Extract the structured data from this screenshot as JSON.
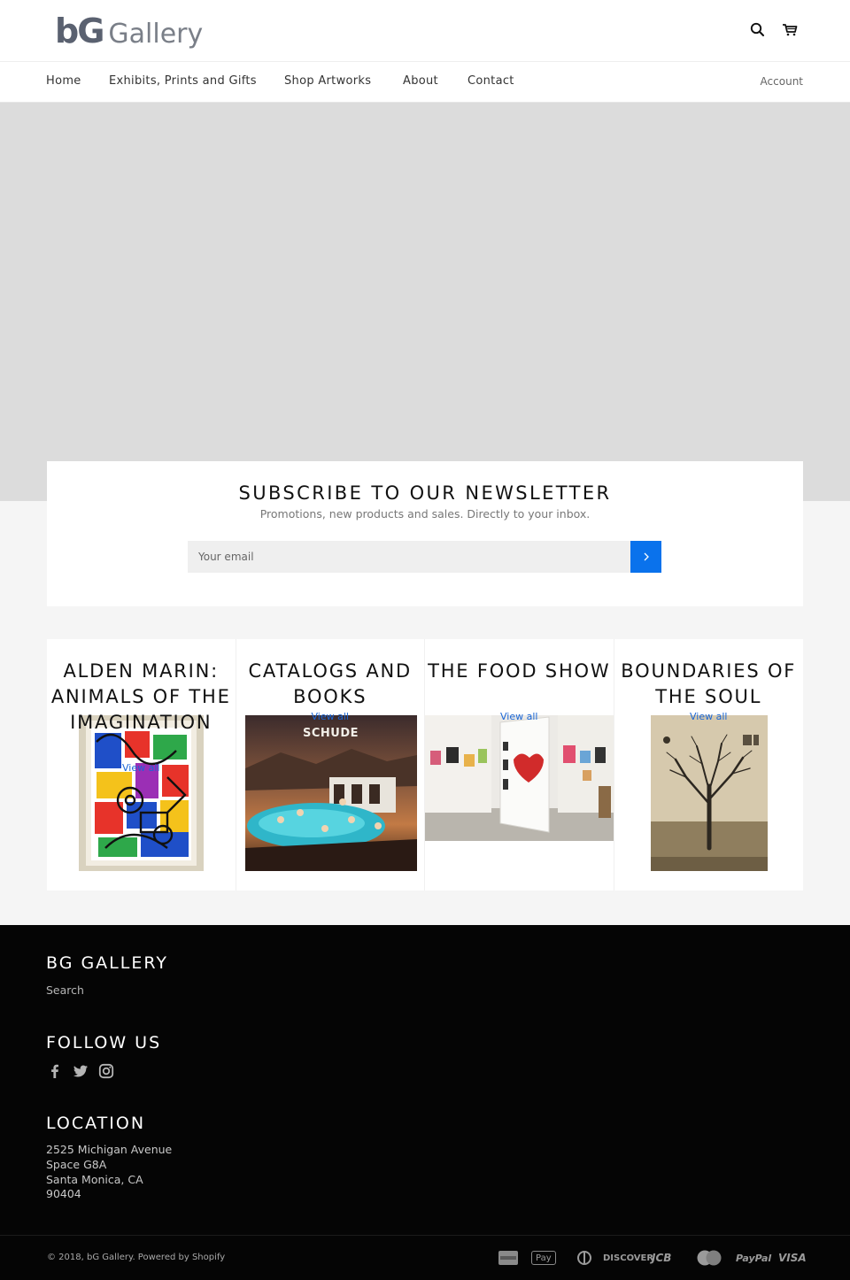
{
  "header": {
    "logo_mark": "bG",
    "logo_word": "Gallery",
    "search_icon": "search-icon",
    "cart_icon": "cart-icon"
  },
  "nav": {
    "items": [
      {
        "label": "Home"
      },
      {
        "label": "Exhibits, Prints and Gifts"
      },
      {
        "label": "Shop Artworks"
      },
      {
        "label": "About"
      },
      {
        "label": "Contact"
      }
    ],
    "account_label": "Account"
  },
  "newsletter": {
    "title": "SUBSCRIBE TO OUR NEWSLETTER",
    "subtitle": "Promotions, new products and sales. Directly to your inbox.",
    "email_placeholder": "Your email",
    "submit_icon": "chevron-right-icon"
  },
  "collections": [
    {
      "title": "ALDEN MARIN: ANIMALS OF THE IMAGINATION",
      "view_all": "View all"
    },
    {
      "title": "CATALOGS AND BOOKS",
      "view_all": "View all",
      "image_text": "SCHUDE"
    },
    {
      "title": "THE FOOD SHOW",
      "view_all": "View all"
    },
    {
      "title": "BOUNDARIES OF THE SOUL",
      "view_all": "View all"
    }
  ],
  "footer": {
    "gallery_heading": "BG GALLERY",
    "search_link": "Search",
    "follow_heading": "FOLLOW US",
    "social_icons": [
      "facebook-icon",
      "twitter-icon",
      "instagram-icon"
    ],
    "location_heading": "LOCATION",
    "address_lines": [
      "2525 Michigan Avenue",
      "Space G8A",
      "Santa Monica, CA",
      "90404"
    ],
    "copyright": "© 2018, bG Gallery. Powered by Shopify",
    "payment_methods": [
      "AMERICAN EXPRESS",
      "Pay",
      "diners",
      "DISCOVER",
      "JCB",
      "MasterCard",
      "PayPal",
      "VISA"
    ]
  },
  "colors": {
    "accent": "#0a72ec",
    "link": "#1a66d6",
    "hero_bg": "#dcdcdc",
    "footer_bg": "#050505"
  }
}
